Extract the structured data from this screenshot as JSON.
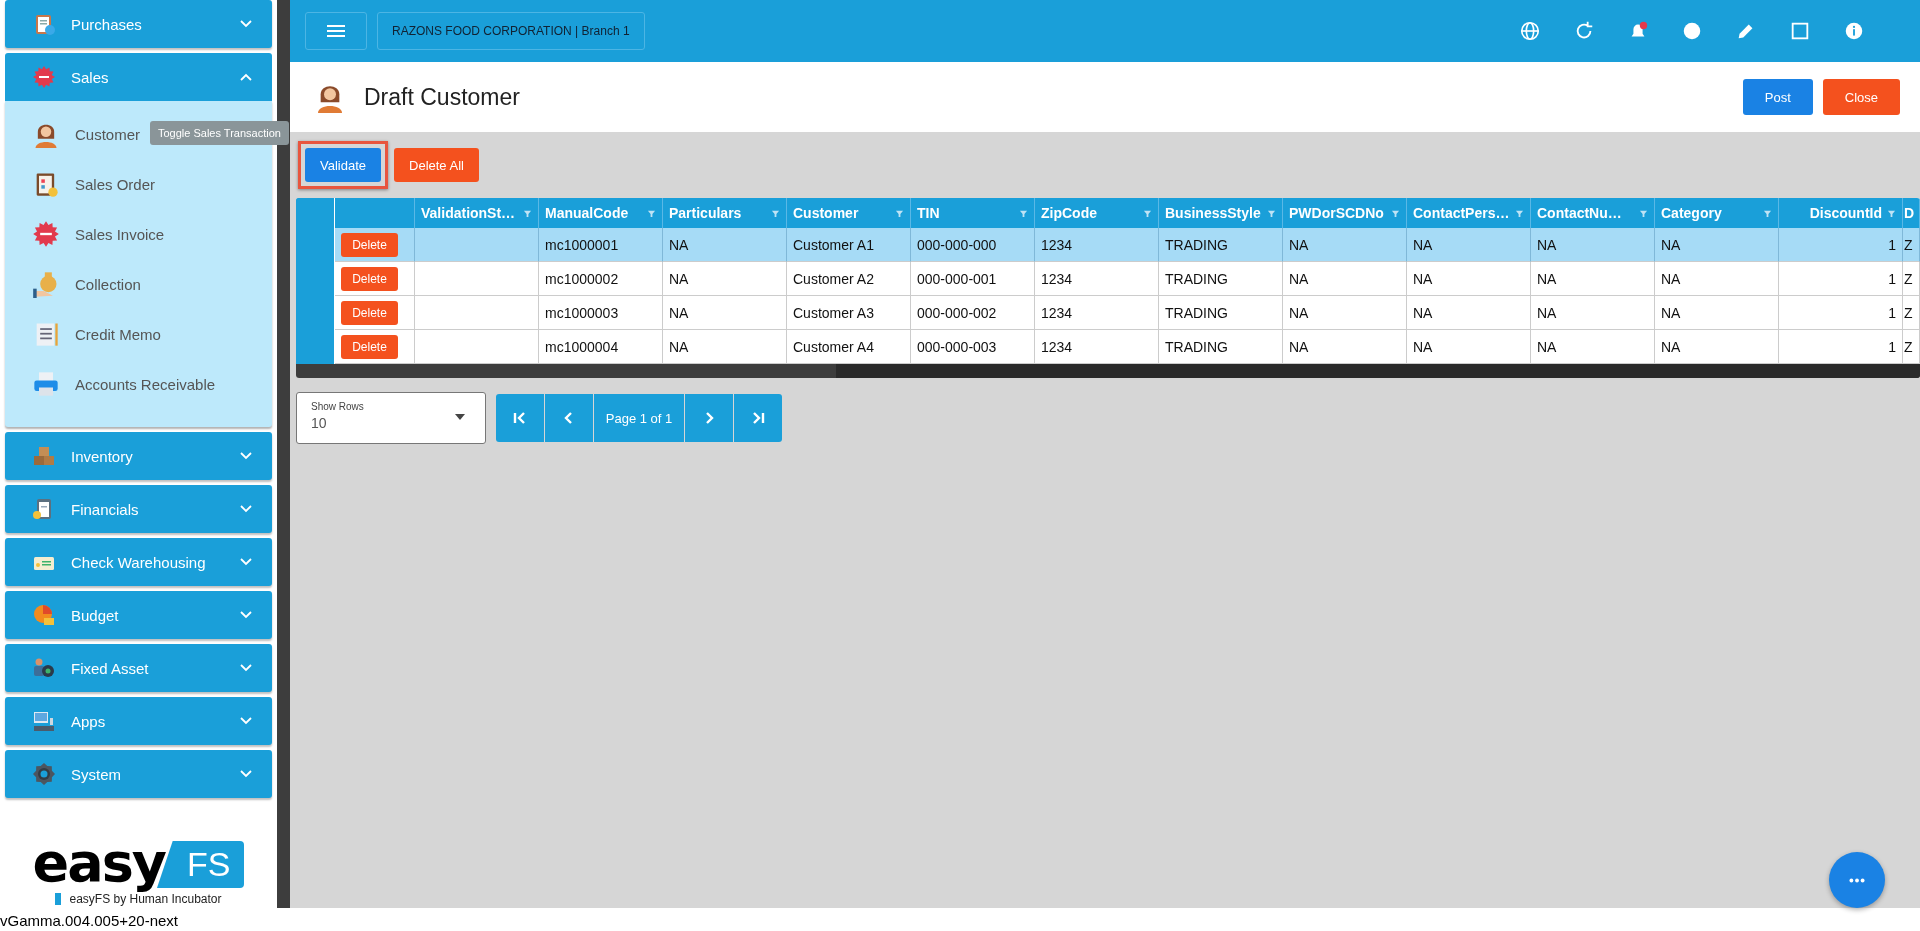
{
  "sidebar": {
    "menus": [
      {
        "label": "Purchases",
        "expanded": false
      },
      {
        "label": "Sales",
        "expanded": true,
        "children": [
          {
            "label": "Customer"
          },
          {
            "label": "Sales Order"
          },
          {
            "label": "Sales Invoice"
          },
          {
            "label": "Collection"
          },
          {
            "label": "Credit Memo"
          },
          {
            "label": "Accounts Receivable"
          }
        ]
      },
      {
        "label": "Inventory",
        "expanded": false
      },
      {
        "label": "Financials",
        "expanded": false
      },
      {
        "label": "Check Warehousing",
        "expanded": false
      },
      {
        "label": "Budget",
        "expanded": false
      },
      {
        "label": "Fixed Asset",
        "expanded": false
      },
      {
        "label": "Apps",
        "expanded": false
      },
      {
        "label": "System",
        "expanded": false
      }
    ],
    "tooltip": "Toggle Sales Transaction",
    "logo": {
      "word": "easy",
      "badge": "FS",
      "tagline": "easyFS by Human Incubator"
    }
  },
  "version": "vGamma.004.005+20-next",
  "topbar": {
    "company": "RAZONS FOOD CORPORATION | Branch 1"
  },
  "page": {
    "title": "Draft Customer",
    "buttons": [
      {
        "label": "Post",
        "kind": "primary"
      },
      {
        "label": "Close",
        "kind": "danger"
      }
    ]
  },
  "toolbar": [
    {
      "label": "Validate",
      "kind": "primary",
      "highlighted": true
    },
    {
      "label": "Delete All",
      "kind": "danger",
      "highlighted": false
    }
  ],
  "table": {
    "columns": [
      {
        "label": "ValidationSt…",
        "numeric": false,
        "filter": true
      },
      {
        "label": "ManualCode",
        "numeric": false,
        "filter": true
      },
      {
        "label": "Particulars",
        "numeric": false,
        "filter": true
      },
      {
        "label": "Customer",
        "numeric": false,
        "filter": true
      },
      {
        "label": "TIN",
        "numeric": false,
        "filter": true
      },
      {
        "label": "ZipCode",
        "numeric": false,
        "filter": true
      },
      {
        "label": "BusinessStyle",
        "numeric": false,
        "filter": true
      },
      {
        "label": "PWDorSCDNo",
        "numeric": false,
        "filter": true
      },
      {
        "label": "ContactPers…",
        "numeric": false,
        "filter": true
      },
      {
        "label": "ContactNu…",
        "numeric": false,
        "filter": true
      },
      {
        "label": "Category",
        "numeric": false,
        "filter": true
      },
      {
        "label": "DiscountId",
        "numeric": true,
        "filter": true
      },
      {
        "label": "D",
        "numeric": false,
        "filter": false
      }
    ],
    "rows": [
      {
        "selected": true,
        "action": "Delete",
        "cells": [
          "",
          "mc1000001",
          "NA",
          "Customer A1",
          "000-000-000",
          "1234",
          "TRADING",
          "NA",
          "NA",
          "NA",
          "NA",
          "1",
          "Z"
        ]
      },
      {
        "selected": false,
        "action": "Delete",
        "cells": [
          "",
          "mc1000002",
          "NA",
          "Customer A2",
          "000-000-001",
          "1234",
          "TRADING",
          "NA",
          "NA",
          "NA",
          "NA",
          "1",
          "Z"
        ]
      },
      {
        "selected": false,
        "action": "Delete",
        "cells": [
          "",
          "mc1000003",
          "NA",
          "Customer A3",
          "000-000-002",
          "1234",
          "TRADING",
          "NA",
          "NA",
          "NA",
          "NA",
          "1",
          "Z"
        ]
      },
      {
        "selected": false,
        "action": "Delete",
        "cells": [
          "",
          "mc1000004",
          "NA",
          "Customer A4",
          "000-000-003",
          "1234",
          "TRADING",
          "NA",
          "NA",
          "NA",
          "NA",
          "1",
          "Z"
        ]
      }
    ]
  },
  "pager": {
    "show_rows_label": "Show Rows",
    "show_rows_value": "10",
    "page_text": "Page 1 of 1"
  }
}
